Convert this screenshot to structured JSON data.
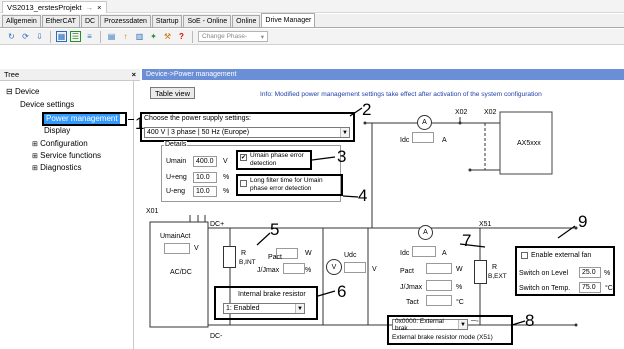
{
  "window": {
    "doc_tab_title": "VS2013_erstesProjekt",
    "doc_tab_pin": "→",
    "doc_tab_close": "×"
  },
  "tabs": [
    "Allgemein",
    "EtherCAT",
    "DC",
    "Prozessdaten",
    "Startup",
    "SoE - Online",
    "Online",
    "Drive Manager"
  ],
  "toolbar": {
    "phase_placeholder": "Change Phase-"
  },
  "tree": {
    "header": "Tree",
    "close": "×",
    "root": "Device",
    "items": [
      "Device settings",
      "Power management",
      "Display",
      "Configuration",
      "Service functions",
      "Diagnostics"
    ]
  },
  "content": {
    "breadcrumb": "Device->Power management",
    "table_view": "Table view",
    "info": "Info: Modified power management settings take effect after activation of the system configuration",
    "supply_label": "Choose the power supply settings:",
    "supply_value": "400 V | 3 phase | 50 Hz (Europe)",
    "details_label": "Details",
    "umain_label": "Umain",
    "umain_value": "400.0",
    "umain_unit": "V",
    "upeng_label": "U+eng",
    "upeng_value": "10.0",
    "upeng_unit": "%",
    "umeng_label": "U-eng",
    "umeng_value": "10.0",
    "umeng_unit": "%",
    "phase_error_label": "Umain phase error detection",
    "phase_error_check": "✔",
    "long_filter_label": "Long filter time for Umain phase error detection",
    "x02a": "X02",
    "x02b": "X02",
    "idc_top": "Idc",
    "idc_top_unit": "A",
    "ax5": "AX5xxx",
    "ammeter": "A",
    "x01": "X01",
    "dc_plus": "DC+",
    "dc_minus": "DC-",
    "umainact": "UmainAct",
    "umainact_unit": "V",
    "acdc": "AC/DC",
    "r_int": "R",
    "r_int_sub": "B,INT",
    "pact_label": "Pact",
    "pact_unit": "W",
    "jjmax_label": "J/Jmax",
    "jjmax_unit": "%",
    "udc_label": "Udc",
    "udc_unit": "V",
    "voltmeter": "V",
    "int_brake_label": "Internal brake resistor",
    "int_brake_value": "1: Enabled",
    "x51": "X51",
    "idc_bot": "Idc",
    "idc_bot_unit": "A",
    "pact2_label": "Pact",
    "pact2_unit": "W",
    "jjmax2_label": "J/Jmax",
    "jjmax2_unit": "%",
    "tact_label": "Tact",
    "tact_unit": "°C",
    "r_ext": "R",
    "r_ext_sub": "B,EXT",
    "ext_fan_label": "Enable external fan",
    "switch_on_level_label": "Switch on Level",
    "switch_on_level_value": "25.0",
    "switch_on_level_unit": "%",
    "switch_on_temp_label": "Switch on Temp.",
    "switch_on_temp_value": "75.0",
    "switch_on_temp_unit": "°C",
    "ext_brake_value": "0x0000: External brak",
    "ext_brake_label": "External brake resistor mode (X51)"
  },
  "callouts": [
    "1",
    "2",
    "3",
    "4",
    "5",
    "6",
    "7",
    "8",
    "9"
  ],
  "colors": {
    "accent_header": "#6b8fd6",
    "selection": "#3399ff",
    "info_text": "#1f3fa8",
    "callout_box": "#000000"
  }
}
